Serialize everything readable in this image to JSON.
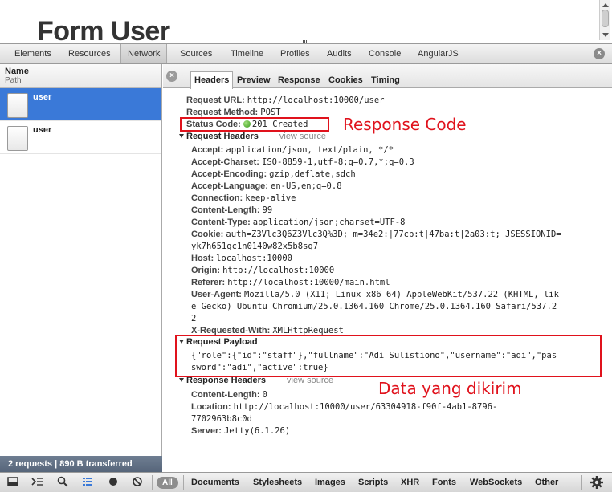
{
  "page": {
    "title": "Form User"
  },
  "devtools": {
    "tabs": [
      "Elements",
      "Resources",
      "Network",
      "Sources",
      "Timeline",
      "Profiles",
      "Audits",
      "Console",
      "AngularJS"
    ],
    "active_tab": "Network"
  },
  "request_list": {
    "header_name": "Name",
    "header_path": "Path",
    "items": [
      {
        "label": "user",
        "selected": true
      },
      {
        "label": "user",
        "selected": false
      }
    ],
    "summary": "2 requests   |   890 B transferred"
  },
  "detail": {
    "tabs": [
      "Headers",
      "Preview",
      "Response",
      "Cookies",
      "Timing"
    ],
    "active_tab": "Headers",
    "general": {
      "request_url_key": "Request URL:",
      "request_url": "http://localhost:10000/user",
      "request_method_key": "Request Method:",
      "request_method": "POST",
      "status_code_key": "Status Code:",
      "status_code": "201 Created"
    },
    "request_headers_title": "Request Headers",
    "view_source": "view source",
    "request_headers": [
      {
        "k": "Accept:",
        "v": "application/json, text/plain, */*"
      },
      {
        "k": "Accept-Charset:",
        "v": "ISO-8859-1,utf-8;q=0.7,*;q=0.3"
      },
      {
        "k": "Accept-Encoding:",
        "v": "gzip,deflate,sdch"
      },
      {
        "k": "Accept-Language:",
        "v": "en-US,en;q=0.8"
      },
      {
        "k": "Connection:",
        "v": "keep-alive"
      },
      {
        "k": "Content-Length:",
        "v": "99"
      },
      {
        "k": "Content-Type:",
        "v": "application/json;charset=UTF-8"
      },
      {
        "k": "Cookie:",
        "v": "auth=Z3Vlc3Q6Z3Vlc3Q%3D; m=34e2:|77cb:t|47ba:t|2a03:t; JSESSIONID="
      },
      {
        "k": "",
        "v": "yk7h651gc1n0140w82x5b8sq7"
      },
      {
        "k": "Host:",
        "v": "localhost:10000"
      },
      {
        "k": "Origin:",
        "v": "http://localhost:10000"
      },
      {
        "k": "Referer:",
        "v": "http://localhost:10000/main.html"
      },
      {
        "k": "User-Agent:",
        "v": "Mozilla/5.0 (X11; Linux x86_64) AppleWebKit/537.22 (KHTML, lik"
      },
      {
        "k": "",
        "v": "e Gecko) Ubuntu Chromium/25.0.1364.160 Chrome/25.0.1364.160 Safari/537.2"
      },
      {
        "k": "",
        "v": "2"
      },
      {
        "k": "X-Requested-With:",
        "v": "XMLHttpRequest"
      }
    ],
    "request_payload_title": "Request Payload",
    "request_payload_line1": "{\"role\":{\"id\":\"staff\"},\"fullname\":\"Adi Sulistiono\",\"username\":\"adi\",\"pas",
    "request_payload_line2": "sword\":\"adi\",\"active\":true}",
    "response_headers_title": "Response Headers",
    "response_headers": [
      {
        "k": "Content-Length:",
        "v": "0"
      },
      {
        "k": "Location:",
        "v": "http://localhost:10000/user/63304918-f90f-4ab1-8796-"
      },
      {
        "k": "",
        "v": "7702963b8c0d"
      },
      {
        "k": "Server:",
        "v": "Jetty(6.1.26)"
      }
    ]
  },
  "annotations": {
    "response_code": "Response Code",
    "data_sent": "Data yang dikirim"
  },
  "bottom_bar": {
    "all_label": "All",
    "filters": [
      "Documents",
      "Stylesheets",
      "Images",
      "Scripts",
      "XHR",
      "Fonts",
      "WebSockets",
      "Other"
    ]
  }
}
